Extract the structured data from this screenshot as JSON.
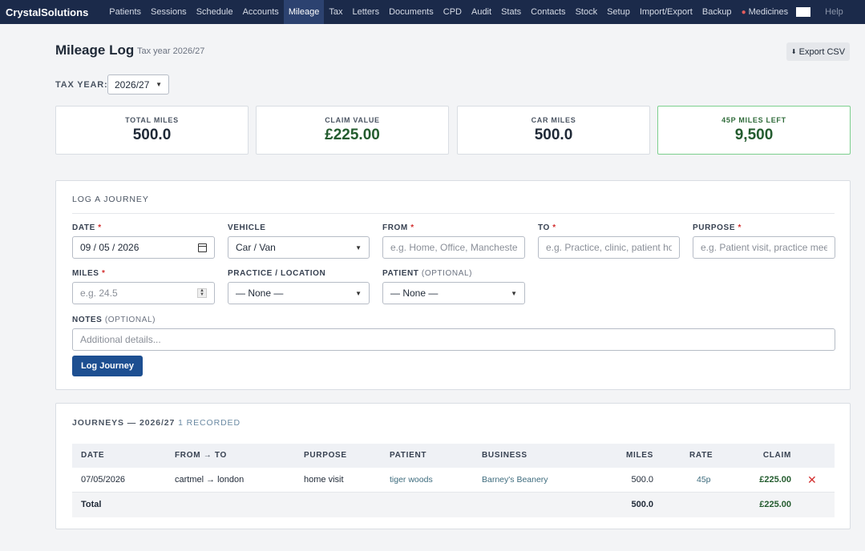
{
  "nav": {
    "brand": "CrystalSolutions",
    "items": [
      "Patients",
      "Sessions",
      "Schedule",
      "Accounts",
      "Mileage",
      "Tax",
      "Letters",
      "Documents",
      "CPD",
      "Audit",
      "Stats",
      "Contacts",
      "Stock",
      "Setup",
      "Import/Export",
      "Backup"
    ],
    "medicines": "Medicines",
    "help": "Help",
    "active_index": 4
  },
  "header": {
    "title": "Mileage Log",
    "subtitle": "Tax year 2026/27",
    "export_label": "Export CSV"
  },
  "tax_year": {
    "label": "TAX YEAR:",
    "value": "2026/27"
  },
  "stats": [
    {
      "label": "TOTAL MILES",
      "value": "500.0"
    },
    {
      "label": "CLAIM VALUE",
      "value": "£225.00"
    },
    {
      "label": "CAR MILES",
      "value": "500.0"
    },
    {
      "label": "45P MILES LEFT",
      "value": "9,500"
    }
  ],
  "form": {
    "title": "LOG A JOURNEY",
    "date": {
      "label": "DATE",
      "value": "09 / 05 / 2026"
    },
    "vehicle": {
      "label": "VEHICLE",
      "value": "Car / Van"
    },
    "from": {
      "label": "FROM",
      "placeholder": "e.g. Home, Office, Manchester"
    },
    "to": {
      "label": "TO",
      "placeholder": "e.g. Practice, clinic, patient home"
    },
    "purpose": {
      "label": "PURPOSE",
      "placeholder": "e.g. Patient visit, practice meeting"
    },
    "miles": {
      "label": "MILES",
      "placeholder": "e.g. 24.5"
    },
    "practice": {
      "label": "PRACTICE / LOCATION",
      "value": "— None —"
    },
    "patient": {
      "label": "PATIENT",
      "optional": "(OPTIONAL)",
      "value": "— None —"
    },
    "notes": {
      "label": "NOTES",
      "optional": "(OPTIONAL)",
      "placeholder": "Additional details..."
    },
    "required_mark": "*",
    "submit_label": "Log Journey"
  },
  "journeys": {
    "title": "JOURNEYS — 2026/27",
    "count": "1 RECORDED",
    "columns": [
      "DATE",
      "FROM → TO",
      "PURPOSE",
      "PATIENT",
      "BUSINESS",
      "MILES",
      "RATE",
      "CLAIM"
    ],
    "rows": [
      {
        "date": "07/05/2026",
        "route": "cartmel → london",
        "purpose": "home visit",
        "patient": "tiger woods",
        "business": "Barney's Beanery",
        "miles": "500.0",
        "rate": "45p",
        "claim": "£225.00",
        "delete": "✕"
      }
    ],
    "total": {
      "label": "Total",
      "miles": "500.0",
      "claim": "£225.00"
    }
  }
}
